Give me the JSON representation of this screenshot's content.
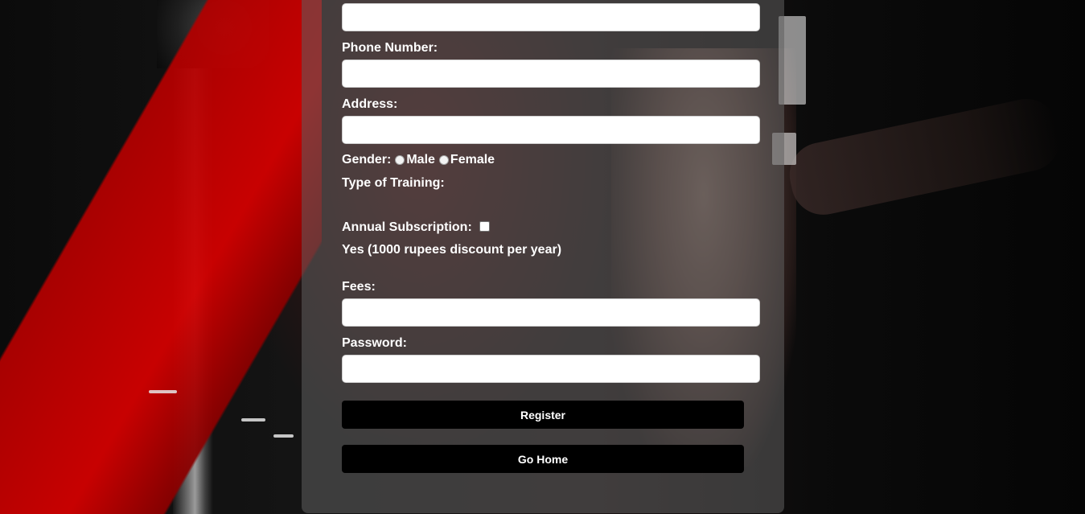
{
  "form": {
    "phone_label": "Phone Number:",
    "address_label": "Address:",
    "gender_label": "Gender:",
    "gender_options": [
      "Male",
      "Female"
    ],
    "training_label": "Type of Training:",
    "subscription_label": "Annual Subscription:",
    "subscription_note": "Yes (1000 rupees discount per year)",
    "fees_label": "Fees:",
    "password_label": "Password:",
    "top_field_value": "",
    "phone_value": "",
    "address_value": "",
    "fees_value": "",
    "password_value": ""
  },
  "buttons": {
    "register": "Register",
    "go_home": "Go Home"
  },
  "colors": {
    "panel": "#5f5f5f",
    "button_bg": "#000000",
    "accent_red": "#d10000"
  }
}
